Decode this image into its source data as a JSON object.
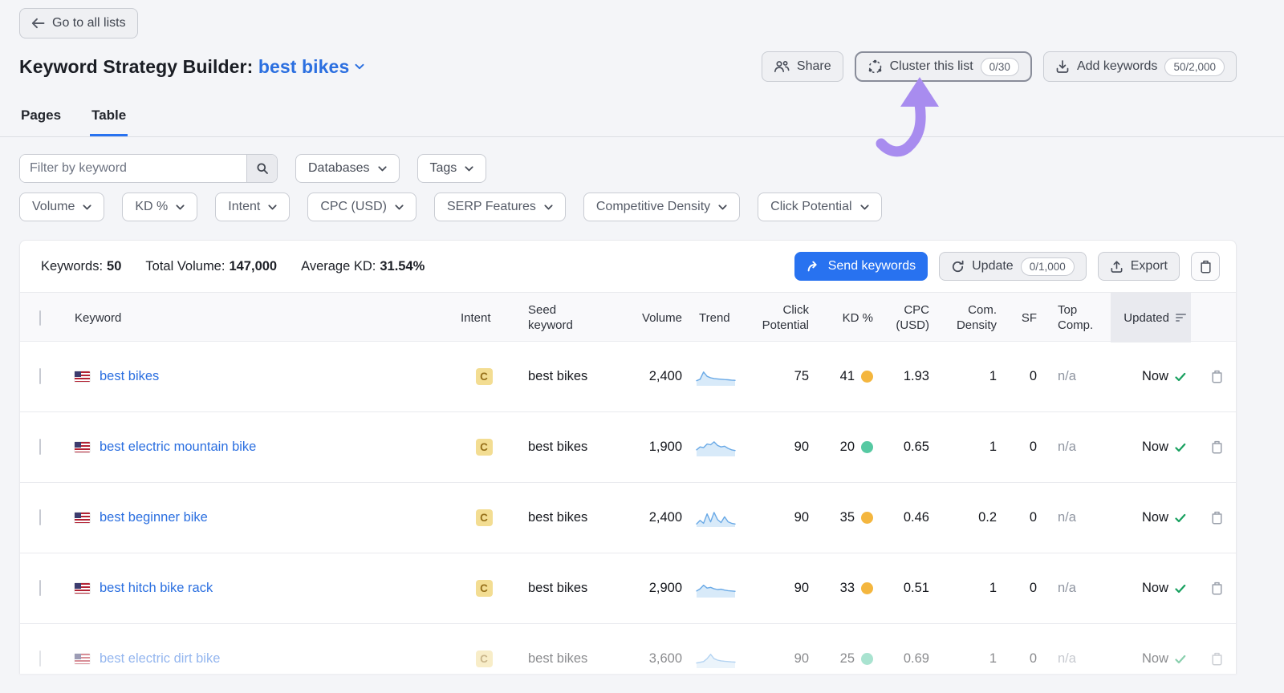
{
  "header": {
    "back_label": "Go to all lists",
    "title": "Keyword Strategy Builder:",
    "list_name": "best bikes",
    "share_label": "Share",
    "cluster_label": "Cluster this list",
    "cluster_badge": "0/30",
    "add_keywords_label": "Add keywords",
    "add_keywords_badge": "50/2,000"
  },
  "tabs": [
    {
      "label": "Pages",
      "active": false
    },
    {
      "label": "Table",
      "active": true
    }
  ],
  "filters": {
    "keyword_placeholder": "Filter by keyword",
    "row1": [
      "Databases",
      "Tags"
    ],
    "row2": [
      "Volume",
      "KD %",
      "Intent",
      "CPC (USD)",
      "SERP Features",
      "Competitive Density",
      "Click Potential"
    ]
  },
  "summary": {
    "keywords_label": "Keywords:",
    "keywords_value": "50",
    "volume_label": "Total Volume:",
    "volume_value": "147,000",
    "kd_label": "Average KD:",
    "kd_value": "31.54%",
    "send_label": "Send keywords",
    "update_label": "Update",
    "update_badge": "0/1,000",
    "export_label": "Export"
  },
  "table": {
    "columns": [
      {
        "l1": "Keyword",
        "l2": ""
      },
      {
        "l1": "Intent",
        "l2": ""
      },
      {
        "l1": "Seed",
        "l2": "keyword"
      },
      {
        "l1": "Volume",
        "l2": ""
      },
      {
        "l1": "Trend",
        "l2": ""
      },
      {
        "l1": "Click",
        "l2": "Potential"
      },
      {
        "l1": "KD %",
        "l2": ""
      },
      {
        "l1": "CPC",
        "l2": "(USD)"
      },
      {
        "l1": "Com.",
        "l2": "Density"
      },
      {
        "l1": "SF",
        "l2": ""
      },
      {
        "l1": "Top",
        "l2": "Comp."
      },
      {
        "l1": "Updated",
        "l2": ""
      }
    ],
    "rows": [
      {
        "keyword": "best bikes",
        "intent": "C",
        "seed": "best bikes",
        "volume": "2,400",
        "trend": [
          3,
          4,
          9,
          6,
          5,
          4.5,
          4.2,
          4,
          3.8,
          3.6,
          3.4,
          3.2
        ],
        "click_potential": "75",
        "kd": "41",
        "kd_level": "medium",
        "cpc": "1.93",
        "com_density": "1",
        "sf": "0",
        "top_comp": "n/a",
        "updated": "Now",
        "faded": false
      },
      {
        "keyword": "best electric mountain bike",
        "intent": "C",
        "seed": "best bikes",
        "volume": "1,900",
        "trend": [
          4,
          6,
          5.5,
          8,
          7.5,
          9.5,
          7,
          6,
          6.5,
          5,
          4,
          3.5
        ],
        "click_potential": "90",
        "kd": "20",
        "kd_level": "easy",
        "cpc": "0.65",
        "com_density": "1",
        "sf": "0",
        "top_comp": "n/a",
        "updated": "Now",
        "faded": false
      },
      {
        "keyword": "best beginner bike",
        "intent": "C",
        "seed": "best bikes",
        "volume": "2,400",
        "trend": [
          1.5,
          4,
          2,
          8.5,
          3,
          9.5,
          4.5,
          2.5,
          6.5,
          3,
          2,
          1.5
        ],
        "click_potential": "90",
        "kd": "35",
        "kd_level": "medium",
        "cpc": "0.46",
        "com_density": "0.2",
        "sf": "0",
        "top_comp": "n/a",
        "updated": "Now",
        "faded": false
      },
      {
        "keyword": "best hitch bike rack",
        "intent": "C",
        "seed": "best bikes",
        "volume": "2,900",
        "trend": [
          4,
          5.5,
          8,
          6,
          6.5,
          5.5,
          5,
          5.2,
          4.6,
          4.2,
          4,
          3.8
        ],
        "click_potential": "90",
        "kd": "33",
        "kd_level": "medium",
        "cpc": "0.51",
        "com_density": "1",
        "sf": "0",
        "top_comp": "n/a",
        "updated": "Now",
        "faded": false
      },
      {
        "keyword": "best electric dirt bike",
        "intent": "C",
        "seed": "best bikes",
        "volume": "3,600",
        "trend": [
          3,
          3.5,
          4,
          6,
          9,
          6,
          5,
          4.5,
          4.2,
          4,
          3.8,
          3.6
        ],
        "click_potential": "90",
        "kd": "25",
        "kd_level": "easy",
        "cpc": "0.69",
        "com_density": "1",
        "sf": "0",
        "top_comp": "n/a",
        "updated": "Now",
        "faded": true
      }
    ]
  },
  "colors": {
    "accent_blue": "#2872F0",
    "link_blue": "#2B6FE0",
    "kd_easy": "#56C9A2",
    "kd_medium": "#F4B63E",
    "intent_commercial_bg": "#F3DD92",
    "intent_commercial_text": "#96701A",
    "arrow_purple": "#A88CEF",
    "success_green": "#18A05F",
    "trend_line": "#69A9E6",
    "trend_fill": "#D8EAF9"
  }
}
